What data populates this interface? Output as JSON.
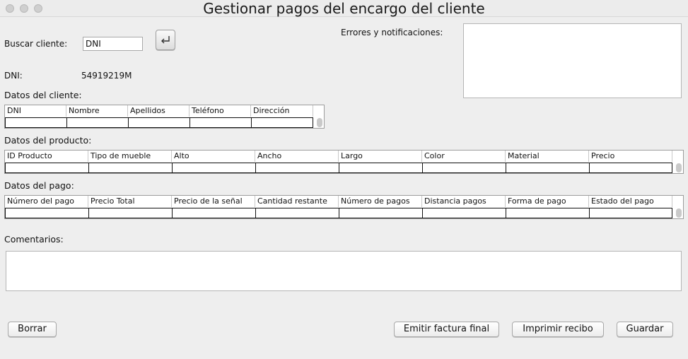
{
  "window": {
    "title": "Gestionar pagos del encargo del cliente"
  },
  "search": {
    "label": "Buscar cliente:",
    "value": "DNI"
  },
  "notifications": {
    "label": "Errores y notificaciones:"
  },
  "dni": {
    "label": "DNI:",
    "value": "54919219M"
  },
  "client_section": {
    "label": "Datos del cliente:",
    "columns": [
      "DNI",
      "Nombre",
      "Apellidos",
      "Teléfono",
      "Dirección"
    ]
  },
  "product_section": {
    "label": "Datos del producto:",
    "columns": [
      "ID Producto",
      "Tipo de mueble",
      "Alto",
      "Ancho",
      "Largo",
      "Color",
      "Material",
      "Precio"
    ]
  },
  "payment_section": {
    "label": "Datos del pago:",
    "columns": [
      "Número del pago",
      "Precio Total",
      "Precio de la señal",
      "Cantidad restante",
      "Número de pagos",
      "Distancia pagos",
      "Forma de pago",
      "Estado del pago"
    ]
  },
  "comments": {
    "label": "Comentarios:"
  },
  "buttons": {
    "clear": "Borrar",
    "final_invoice": "Emitir factura final",
    "print_receipt": "Imprimir recibo",
    "save": "Guardar"
  },
  "icons": {
    "search_submit": "enter-return-icon",
    "window_controls": [
      "close-icon",
      "minimize-icon",
      "maximize-icon"
    ]
  }
}
